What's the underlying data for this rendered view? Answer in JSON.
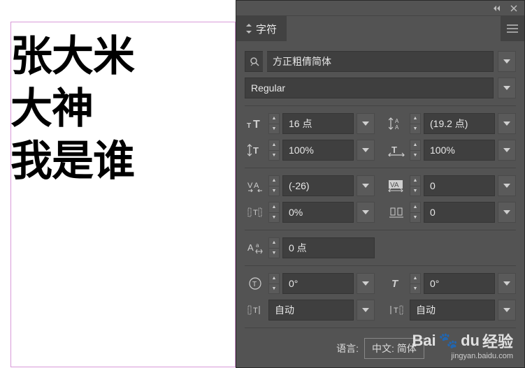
{
  "canvas": {
    "line1": "张大米",
    "line2": "大神",
    "line3": "我是谁"
  },
  "panel": {
    "tab_title": "字符",
    "font_family": "方正粗倩简体",
    "font_style": "Regular",
    "font_size": "16 点",
    "leading": "(19.2 点)",
    "vert_scale": "100%",
    "horiz_scale": "100%",
    "kerning": "(-26)",
    "tracking": "0",
    "baseline": "0%",
    "aki": "0",
    "tsume": "0 点",
    "rotation": "0°",
    "skew": "0°",
    "justify_left": "自动",
    "justify_right": "自动",
    "lang_label": "语言:",
    "lang_value": "中文: 简体"
  },
  "watermark": {
    "brand_a": "Bai",
    "brand_b": "du",
    "brand_c": "经验",
    "url": "jingyan.baidu.com"
  }
}
